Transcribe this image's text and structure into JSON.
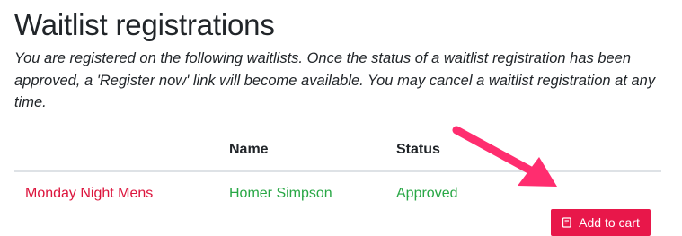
{
  "page": {
    "title": "Waitlist registrations",
    "intro": "You are registered on the following waitlists. Once the status of a waitlist registration has been approved, a 'Register now' link will become available. You may cancel a waitlist registration at any time."
  },
  "table": {
    "headers": [
      "",
      "Name",
      "Status",
      ""
    ],
    "rows": [
      {
        "event": "Monday Night Mens",
        "name": "Homer Simpson",
        "status": "Approved",
        "action_label": "Add to cart",
        "action_icon": "cart-note-icon"
      }
    ]
  },
  "annotation": {
    "arrow_color": "#ff2d6f",
    "points_to": "add-to-cart-button"
  },
  "colors": {
    "event_link": "#dc143c",
    "status_approved": "#28a745",
    "button_bg": "#e8174a"
  }
}
